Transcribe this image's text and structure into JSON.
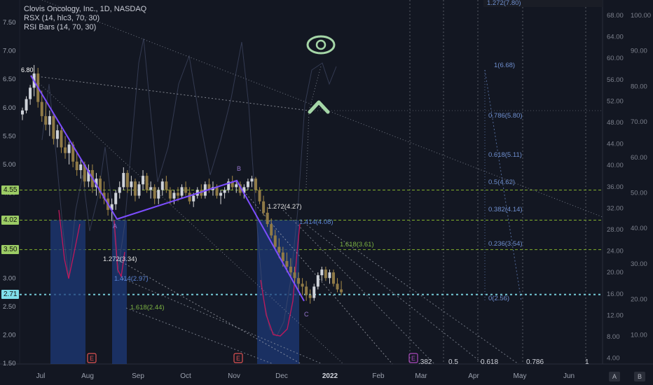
{
  "legend": {
    "title": "Clovis Oncology, Inc., 1D, NASDAQ",
    "ind1": "RSX (14, hlc3, 70, 30)",
    "ind2": "RSI Bars (14, 70, 30)"
  },
  "chart_data": {
    "type": "candlestick",
    "title": "Clovis Oncology, Inc., 1D, NASDAQ",
    "left_axis": {
      "ticks": [
        "7.50",
        "7.00",
        "6.50",
        "6.00",
        "5.50",
        "5.00",
        "4.50",
        "4.00",
        "3.50",
        "3.00",
        "2.50",
        "2.00",
        "1.50"
      ],
      "ylim": [
        1.5,
        7.5
      ]
    },
    "right_axis_a": {
      "ticks": [
        "68.00",
        "64.00",
        "60.00",
        "56.00",
        "52.00",
        "48.00",
        "44.00",
        "40.00",
        "36.00",
        "32.00",
        "28.00",
        "24.00",
        "20.00",
        "16.00",
        "12.00",
        "8.00",
        "4.00"
      ]
    },
    "right_axis_b": {
      "ticks": [
        "100.00",
        "90.00",
        "80.00",
        "70.00",
        "60.00",
        "50.00",
        "40.00",
        "30.00",
        "20.00",
        "10.00"
      ]
    },
    "x_ticks": [
      "Jul",
      "Aug",
      "Sep",
      "Oct",
      "Nov",
      "Dec",
      "2022",
      "Feb",
      "Mar",
      "Apr",
      "May",
      "Jun"
    ],
    "horizontal_levels": [
      {
        "label": "4.55",
        "value": 4.55,
        "color": "#a6e22e"
      },
      {
        "label": "4.02",
        "value": 4.02,
        "color": "#a6e22e"
      },
      {
        "label": "3.50",
        "value": 3.5,
        "color": "#a6e22e"
      },
      {
        "label": "2.71",
        "value": 2.71,
        "color": "#80deea"
      }
    ],
    "wave_points": [
      {
        "label": "A",
        "date": "2021-08-21",
        "value": 4.05
      },
      {
        "label": "B",
        "date": "2021-11-01",
        "value": 4.72
      },
      {
        "label": "C",
        "date": "2021-12-14",
        "value": 2.55
      }
    ],
    "fib_extension_labels": [
      "1.272(4.27)",
      "1.414(4.08)",
      "1.618(3.61)",
      "1.272(3.34)",
      "1.414(2.97)",
      "1.618(2.44)"
    ],
    "fib_retracement_labels": [
      "1.272(7.80)",
      "1(6.68)",
      "0.786(5.80)",
      "0.618(5.11)",
      "0.5(4.62)",
      "0.382(4.14)",
      "0.236(3.54)",
      "0(2.56)"
    ],
    "fib_time_labels": [
      ".382",
      "0.5",
      "0.618",
      "0.786",
      "1"
    ],
    "peak_label": "6.80",
    "candles": [
      {
        "t": 0,
        "o": 5.88,
        "h": 6.0,
        "l": 5.78,
        "c": 5.95
      },
      {
        "t": 1,
        "o": 5.95,
        "h": 6.2,
        "l": 5.9,
        "c": 6.15
      },
      {
        "t": 2,
        "o": 6.15,
        "h": 6.4,
        "l": 6.05,
        "c": 6.35
      },
      {
        "t": 3,
        "o": 6.35,
        "h": 6.75,
        "l": 6.2,
        "c": 6.6
      },
      {
        "t": 4,
        "o": 6.6,
        "h": 6.7,
        "l": 6.0,
        "c": 6.1
      },
      {
        "t": 5,
        "o": 6.1,
        "h": 6.3,
        "l": 5.75,
        "c": 5.85
      },
      {
        "t": 6,
        "o": 5.85,
        "h": 6.1,
        "l": 5.6,
        "c": 5.7
      },
      {
        "t": 7,
        "o": 5.7,
        "h": 5.95,
        "l": 5.5,
        "c": 5.85
      },
      {
        "t": 8,
        "o": 5.85,
        "h": 5.9,
        "l": 5.35,
        "c": 5.45
      },
      {
        "t": 9,
        "o": 5.45,
        "h": 5.7,
        "l": 5.3,
        "c": 5.6
      },
      {
        "t": 10,
        "o": 5.6,
        "h": 5.65,
        "l": 5.2,
        "c": 5.3
      },
      {
        "t": 11,
        "o": 5.3,
        "h": 5.5,
        "l": 5.1,
        "c": 5.2
      },
      {
        "t": 12,
        "o": 5.2,
        "h": 5.4,
        "l": 5.0,
        "c": 5.35
      },
      {
        "t": 13,
        "o": 5.35,
        "h": 5.4,
        "l": 4.95,
        "c": 5.05
      },
      {
        "t": 14,
        "o": 5.05,
        "h": 5.2,
        "l": 4.8,
        "c": 4.9
      },
      {
        "t": 15,
        "o": 4.9,
        "h": 5.1,
        "l": 4.75,
        "c": 5.0
      },
      {
        "t": 16,
        "o": 5.0,
        "h": 5.05,
        "l": 4.6,
        "c": 4.7
      },
      {
        "t": 17,
        "o": 4.7,
        "h": 5.0,
        "l": 4.6,
        "c": 4.9
      },
      {
        "t": 18,
        "o": 4.9,
        "h": 5.0,
        "l": 4.5,
        "c": 4.6
      },
      {
        "t": 19,
        "o": 4.6,
        "h": 4.85,
        "l": 4.45,
        "c": 4.75
      },
      {
        "t": 20,
        "o": 4.75,
        "h": 4.8,
        "l": 4.4,
        "c": 4.5
      },
      {
        "t": 21,
        "o": 4.5,
        "h": 4.7,
        "l": 4.3,
        "c": 4.4
      },
      {
        "t": 22,
        "o": 4.4,
        "h": 4.5,
        "l": 4.1,
        "c": 4.2
      },
      {
        "t": 23,
        "o": 4.2,
        "h": 4.4,
        "l": 4.0,
        "c": 4.3
      },
      {
        "t": 24,
        "o": 4.3,
        "h": 4.55,
        "l": 4.2,
        "c": 4.5
      },
      {
        "t": 25,
        "o": 4.5,
        "h": 4.7,
        "l": 4.4,
        "c": 4.6
      },
      {
        "t": 26,
        "o": 4.6,
        "h": 4.95,
        "l": 4.55,
        "c": 4.85
      },
      {
        "t": 27,
        "o": 4.85,
        "h": 4.9,
        "l": 4.5,
        "c": 4.6
      },
      {
        "t": 28,
        "o": 4.6,
        "h": 4.8,
        "l": 4.45,
        "c": 4.7
      },
      {
        "t": 29,
        "o": 4.7,
        "h": 4.75,
        "l": 4.35,
        "c": 4.45
      },
      {
        "t": 30,
        "o": 4.45,
        "h": 4.7,
        "l": 4.4,
        "c": 4.65
      },
      {
        "t": 31,
        "o": 4.65,
        "h": 4.9,
        "l": 4.55,
        "c": 4.8
      },
      {
        "t": 32,
        "o": 4.8,
        "h": 4.85,
        "l": 4.5,
        "c": 4.55
      },
      {
        "t": 33,
        "o": 4.55,
        "h": 4.7,
        "l": 4.4,
        "c": 4.6
      },
      {
        "t": 34,
        "o": 4.6,
        "h": 4.65,
        "l": 4.3,
        "c": 4.4
      },
      {
        "t": 35,
        "o": 4.4,
        "h": 4.6,
        "l": 4.3,
        "c": 4.55
      },
      {
        "t": 36,
        "o": 4.55,
        "h": 4.75,
        "l": 4.45,
        "c": 4.7
      },
      {
        "t": 37,
        "o": 4.7,
        "h": 4.8,
        "l": 4.5,
        "c": 4.55
      },
      {
        "t": 38,
        "o": 4.55,
        "h": 4.6,
        "l": 4.3,
        "c": 4.4
      },
      {
        "t": 39,
        "o": 4.4,
        "h": 4.55,
        "l": 4.3,
        "c": 4.5
      },
      {
        "t": 40,
        "o": 4.5,
        "h": 4.6,
        "l": 4.35,
        "c": 4.45
      },
      {
        "t": 41,
        "o": 4.45,
        "h": 4.65,
        "l": 4.4,
        "c": 4.6
      },
      {
        "t": 42,
        "o": 4.6,
        "h": 4.7,
        "l": 4.45,
        "c": 4.5
      },
      {
        "t": 43,
        "o": 4.5,
        "h": 4.6,
        "l": 4.3,
        "c": 4.35
      },
      {
        "t": 44,
        "o": 4.35,
        "h": 4.5,
        "l": 4.25,
        "c": 4.45
      },
      {
        "t": 45,
        "o": 4.45,
        "h": 4.6,
        "l": 4.4,
        "c": 4.55
      },
      {
        "t": 46,
        "o": 4.55,
        "h": 4.65,
        "l": 4.4,
        "c": 4.45
      },
      {
        "t": 47,
        "o": 4.45,
        "h": 4.7,
        "l": 4.4,
        "c": 4.65
      },
      {
        "t": 48,
        "o": 4.65,
        "h": 4.75,
        "l": 4.5,
        "c": 4.55
      },
      {
        "t": 49,
        "o": 4.55,
        "h": 4.7,
        "l": 4.45,
        "c": 4.6
      },
      {
        "t": 50,
        "o": 4.6,
        "h": 4.65,
        "l": 4.4,
        "c": 4.45
      },
      {
        "t": 51,
        "o": 4.45,
        "h": 4.55,
        "l": 4.3,
        "c": 4.5
      },
      {
        "t": 52,
        "o": 4.5,
        "h": 4.6,
        "l": 4.4,
        "c": 4.55
      },
      {
        "t": 53,
        "o": 4.55,
        "h": 4.75,
        "l": 4.5,
        "c": 4.7
      },
      {
        "t": 54,
        "o": 4.7,
        "h": 4.8,
        "l": 4.55,
        "c": 4.6
      },
      {
        "t": 55,
        "o": 4.6,
        "h": 4.7,
        "l": 4.5,
        "c": 4.65
      },
      {
        "t": 56,
        "o": 4.65,
        "h": 4.7,
        "l": 4.45,
        "c": 4.5
      },
      {
        "t": 57,
        "o": 4.5,
        "h": 4.65,
        "l": 4.4,
        "c": 4.6
      },
      {
        "t": 58,
        "o": 4.6,
        "h": 4.75,
        "l": 4.55,
        "c": 4.7
      },
      {
        "t": 59,
        "o": 4.7,
        "h": 4.8,
        "l": 4.6,
        "c": 4.75
      },
      {
        "t": 60,
        "o": 4.75,
        "h": 4.78,
        "l": 4.5,
        "c": 4.55
      },
      {
        "t": 61,
        "o": 4.55,
        "h": 4.6,
        "l": 4.3,
        "c": 4.35
      },
      {
        "t": 62,
        "o": 4.35,
        "h": 4.45,
        "l": 4.1,
        "c": 4.15
      },
      {
        "t": 63,
        "o": 4.15,
        "h": 4.25,
        "l": 3.9,
        "c": 3.95
      },
      {
        "t": 64,
        "o": 3.95,
        "h": 4.05,
        "l": 3.7,
        "c": 3.75
      },
      {
        "t": 65,
        "o": 3.75,
        "h": 3.85,
        "l": 3.5,
        "c": 3.55
      },
      {
        "t": 66,
        "o": 3.55,
        "h": 3.7,
        "l": 3.35,
        "c": 3.45
      },
      {
        "t": 67,
        "o": 3.45,
        "h": 3.55,
        "l": 3.2,
        "c": 3.3
      },
      {
        "t": 68,
        "o": 3.3,
        "h": 3.45,
        "l": 3.1,
        "c": 3.2
      },
      {
        "t": 69,
        "o": 3.2,
        "h": 3.35,
        "l": 3.0,
        "c": 3.1
      },
      {
        "t": 70,
        "o": 3.1,
        "h": 3.2,
        "l": 2.9,
        "c": 3.0
      },
      {
        "t": 71,
        "o": 3.0,
        "h": 3.1,
        "l": 2.8,
        "c": 2.9
      },
      {
        "t": 72,
        "o": 2.9,
        "h": 3.0,
        "l": 2.7,
        "c": 2.85
      },
      {
        "t": 73,
        "o": 2.85,
        "h": 2.95,
        "l": 2.6,
        "c": 2.7
      },
      {
        "t": 74,
        "o": 2.7,
        "h": 2.8,
        "l": 2.55,
        "c": 2.65
      },
      {
        "t": 75,
        "o": 2.65,
        "h": 2.9,
        "l": 2.6,
        "c": 2.85
      },
      {
        "t": 76,
        "o": 2.85,
        "h": 3.1,
        "l": 2.8,
        "c": 3.05
      },
      {
        "t": 77,
        "o": 3.05,
        "h": 3.2,
        "l": 2.95,
        "c": 3.15
      },
      {
        "t": 78,
        "o": 3.15,
        "h": 3.2,
        "l": 2.95,
        "c": 3.0
      },
      {
        "t": 79,
        "o": 3.0,
        "h": 3.15,
        "l": 2.9,
        "c": 3.1
      },
      {
        "t": 80,
        "o": 3.1,
        "h": 3.15,
        "l": 2.85,
        "c": 2.9
      },
      {
        "t": 81,
        "o": 2.9,
        "h": 3.0,
        "l": 2.75,
        "c": 2.8
      },
      {
        "t": 82,
        "o": 2.8,
        "h": 2.95,
        "l": 2.7,
        "c": 2.75
      }
    ]
  },
  "markers": {
    "earnings": "E"
  },
  "buttons": {
    "auto": "A",
    "log": "B"
  }
}
